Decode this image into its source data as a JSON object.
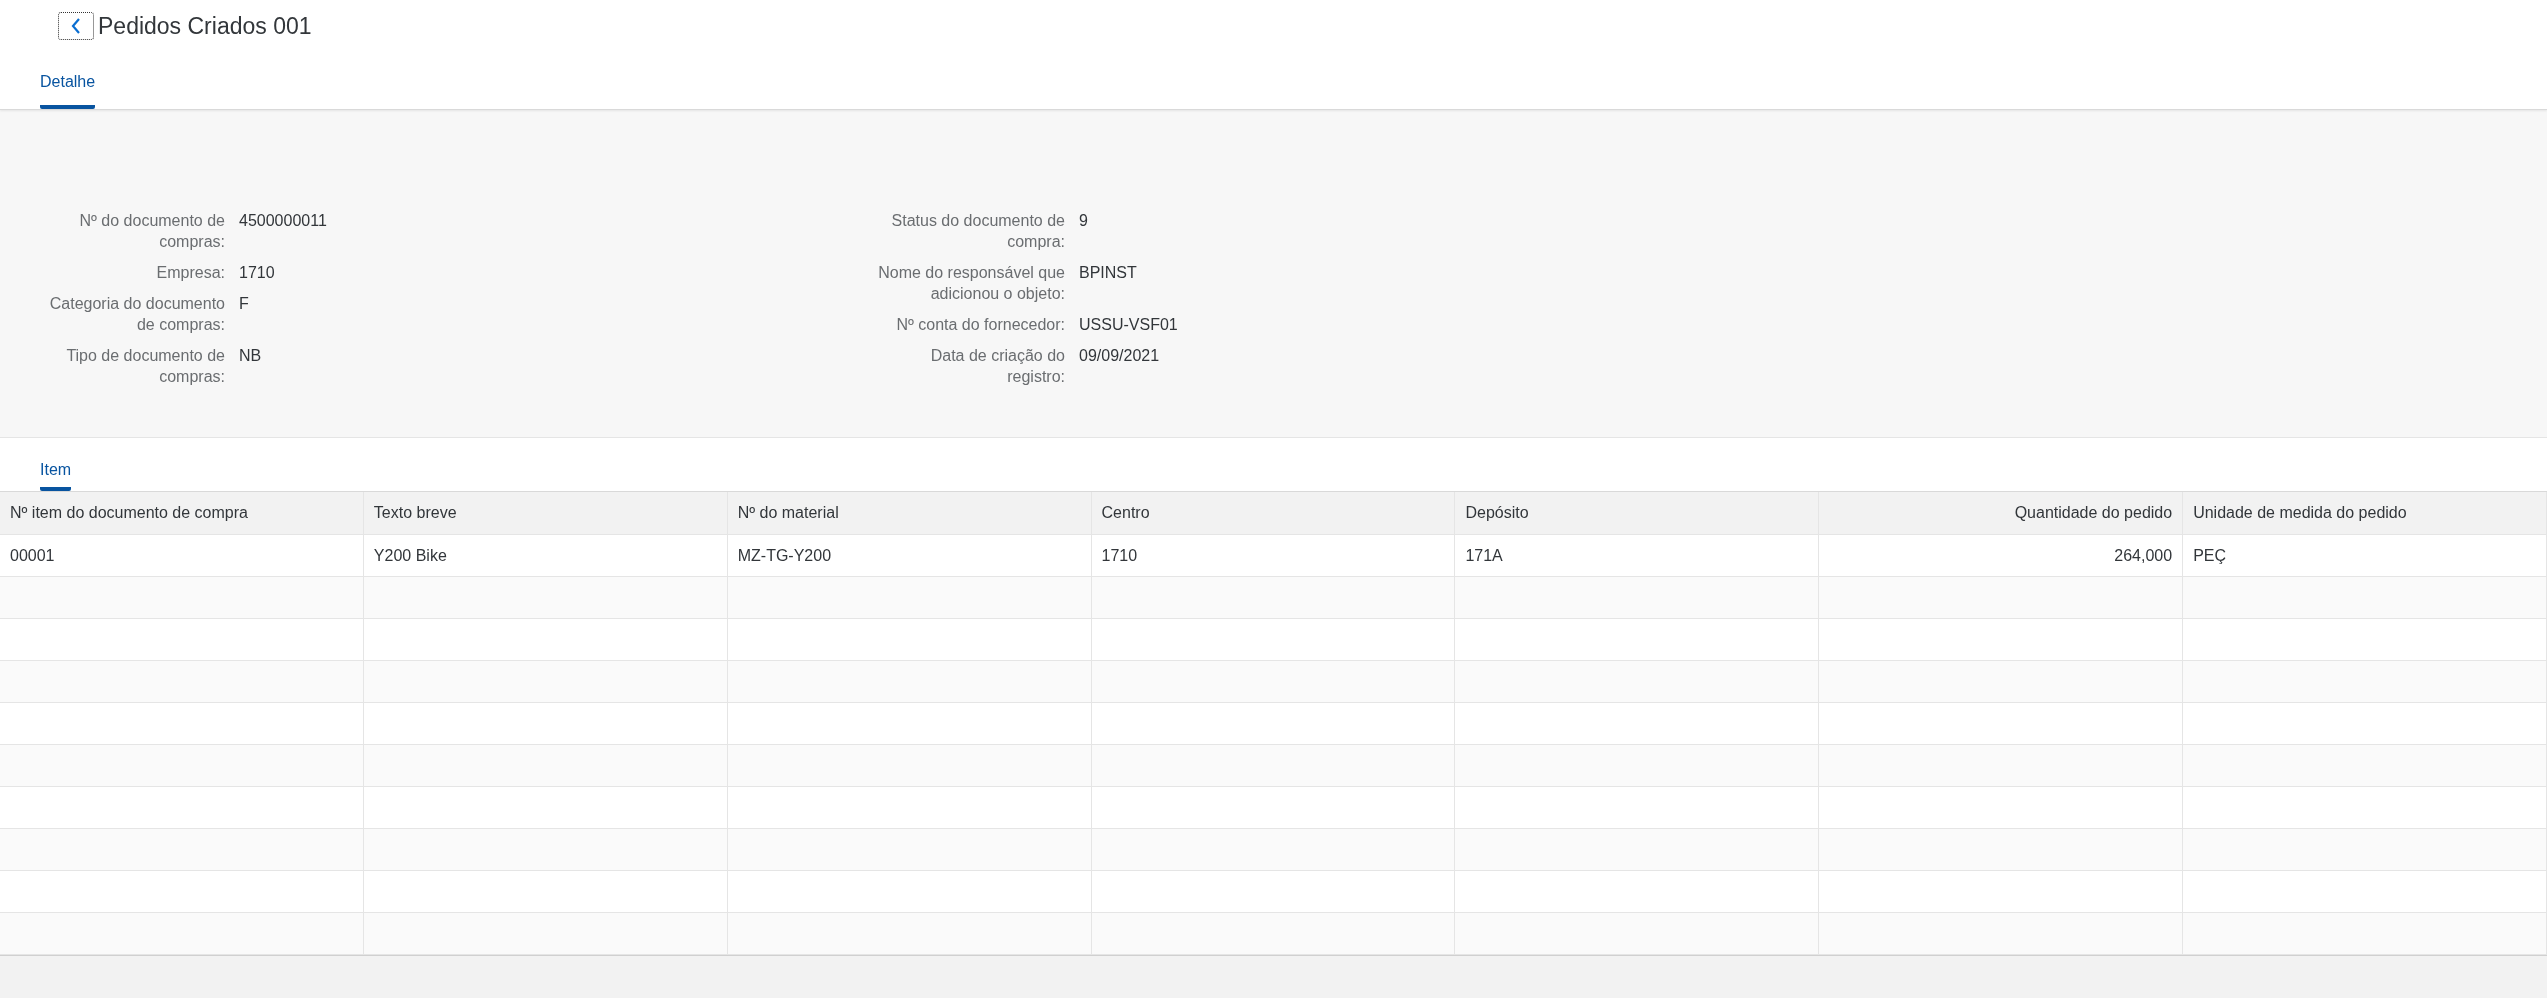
{
  "header": {
    "title": "Pedidos Criados 001"
  },
  "tabs": [
    {
      "label": "Detalhe",
      "selected": true
    }
  ],
  "details": {
    "left": [
      {
        "label": "Nº do documento de compras:",
        "value": "4500000011"
      },
      {
        "label": "Empresa:",
        "value": "1710"
      },
      {
        "label": "Categoria do documento de compras:",
        "value": "F"
      },
      {
        "label": "Tipo de documento de compras:",
        "value": "NB"
      }
    ],
    "right": [
      {
        "label": "Status do documento de compra:",
        "value": "9"
      },
      {
        "label": "Nome do responsável que adicionou o objeto:",
        "value": "BPINST"
      },
      {
        "label": "Nº conta do fornecedor:",
        "value": "USSU-VSF01"
      },
      {
        "label": "Data de criação do registro:",
        "value": "09/09/2021"
      }
    ]
  },
  "section_tabs": [
    {
      "label": "Item",
      "selected": true
    }
  ],
  "table": {
    "columns": [
      {
        "label": "Nº item do documento de compra",
        "kind": "text"
      },
      {
        "label": "Texto breve",
        "kind": "text"
      },
      {
        "label": "Nº do material",
        "kind": "text"
      },
      {
        "label": "Centro",
        "kind": "text"
      },
      {
        "label": "Depósito",
        "kind": "text"
      },
      {
        "label": "Quantidade do pedido",
        "kind": "number"
      },
      {
        "label": "Unidade de medida do pedido",
        "kind": "text"
      }
    ],
    "rows": [
      [
        "00001",
        "Y200 Bike",
        "MZ-TG-Y200",
        "1710",
        "171A",
        "264,000",
        "PEÇ"
      ]
    ]
  }
}
